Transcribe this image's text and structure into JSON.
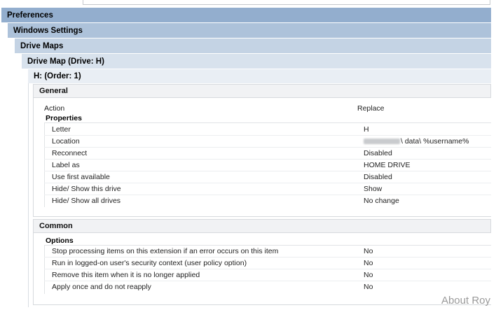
{
  "headers": {
    "h1": "Preferences",
    "h2": "Windows Settings",
    "h3": "Drive Maps",
    "h4": "Drive Map (Drive: H)",
    "h5": "H: (Order: 1)"
  },
  "general": {
    "title": "General",
    "action_label": "Action",
    "action_value": "Replace",
    "properties_title": "Properties",
    "properties": [
      {
        "label": "Letter",
        "value": "H"
      },
      {
        "label": "Location",
        "value": "\\ data\\ %username%"
      },
      {
        "label": "Reconnect",
        "value": "Disabled"
      },
      {
        "label": "Label as",
        "value": "HOME DRIVE"
      },
      {
        "label": "Use first available",
        "value": "Disabled"
      },
      {
        "label": "Hide/ Show this drive",
        "value": "Show"
      },
      {
        "label": "Hide/ Show all drives",
        "value": "No change"
      }
    ]
  },
  "common": {
    "title": "Common",
    "options_title": "Options",
    "options": [
      {
        "label": "Stop processing items on this extension if an error occurs on this item",
        "value": "No"
      },
      {
        "label": "Run in logged-on user's security context (user policy option)",
        "value": "No"
      },
      {
        "label": "Remove this item when it is no longer applied",
        "value": "No"
      },
      {
        "label": "Apply once and do not reapply",
        "value": "No"
      }
    ]
  },
  "watermark": "About Roy"
}
